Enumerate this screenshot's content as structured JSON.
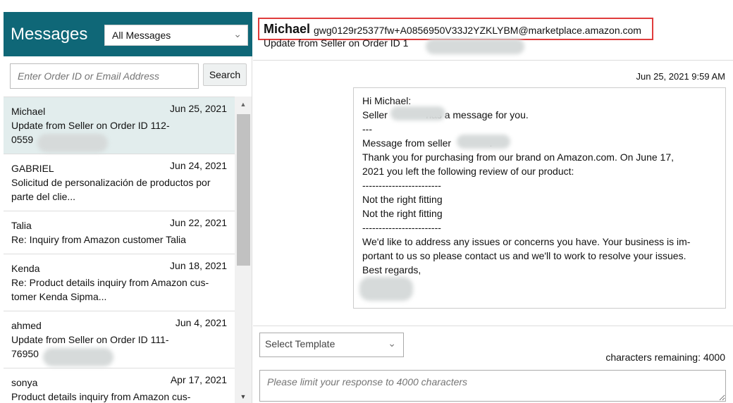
{
  "sidebar": {
    "title": "Messages",
    "filter": "All Messages",
    "search_placeholder": "Enter Order ID or Email Address",
    "search_label": "Search",
    "items": [
      {
        "name": "Michael",
        "date": "Jun 25, 2021",
        "subject": "Update from Seller on Order ID 112-\n0559"
      },
      {
        "name": "GABRIEL",
        "date": "Jun 24, 2021",
        "subject": "Solicitud de personalización de productos por\nparte del clie..."
      },
      {
        "name": "Talia",
        "date": "Jun 22, 2021",
        "subject": "Re: Inquiry from Amazon customer Talia"
      },
      {
        "name": "Kenda",
        "date": "Jun 18, 2021",
        "subject": "Re: Product details inquiry from Amazon cus-\ntomer Kenda Sipma..."
      },
      {
        "name": "ahmed",
        "date": "Jun 4, 2021",
        "subject": "Update from Seller on Order ID 111-\n76950"
      },
      {
        "name": "sonya",
        "date": "Apr 17, 2021",
        "subject": "Product details inquiry from Amazon cus-"
      }
    ]
  },
  "conversation": {
    "name": "Michael",
    "email": "gwg0129r25377fw+A0856950V33J2YZKLYBM@marketplace.amazon.com",
    "subject": "Update from Seller on Order ID 1",
    "timestamp": "Jun 25, 2021 9:59 AM",
    "lines": [
      "Hi Michael:",
      "Seller              has a message for you.",
      "---",
      "Message from seller              :",
      "Thank you for purchasing from our brand on Amazon.com. On June 17,",
      "2021 you left the following review of our product:",
      "------------------------",
      "Not the right fitting",
      "Not the right fitting",
      "------------------------",
      "We'd like to address any issues or concerns you have. Your business is im-",
      "portant to us so please contact us and we'll to work to resolve your issues.",
      "Best regards,",
      ""
    ]
  },
  "reply": {
    "template": "Select Template",
    "chars_remaining": "characters remaining: 4000",
    "placeholder": "Please limit your response to 4000 characters"
  },
  "colors": {
    "header": "#0f6777",
    "highlight": "#e03c3c",
    "selected": "#e2eded"
  }
}
